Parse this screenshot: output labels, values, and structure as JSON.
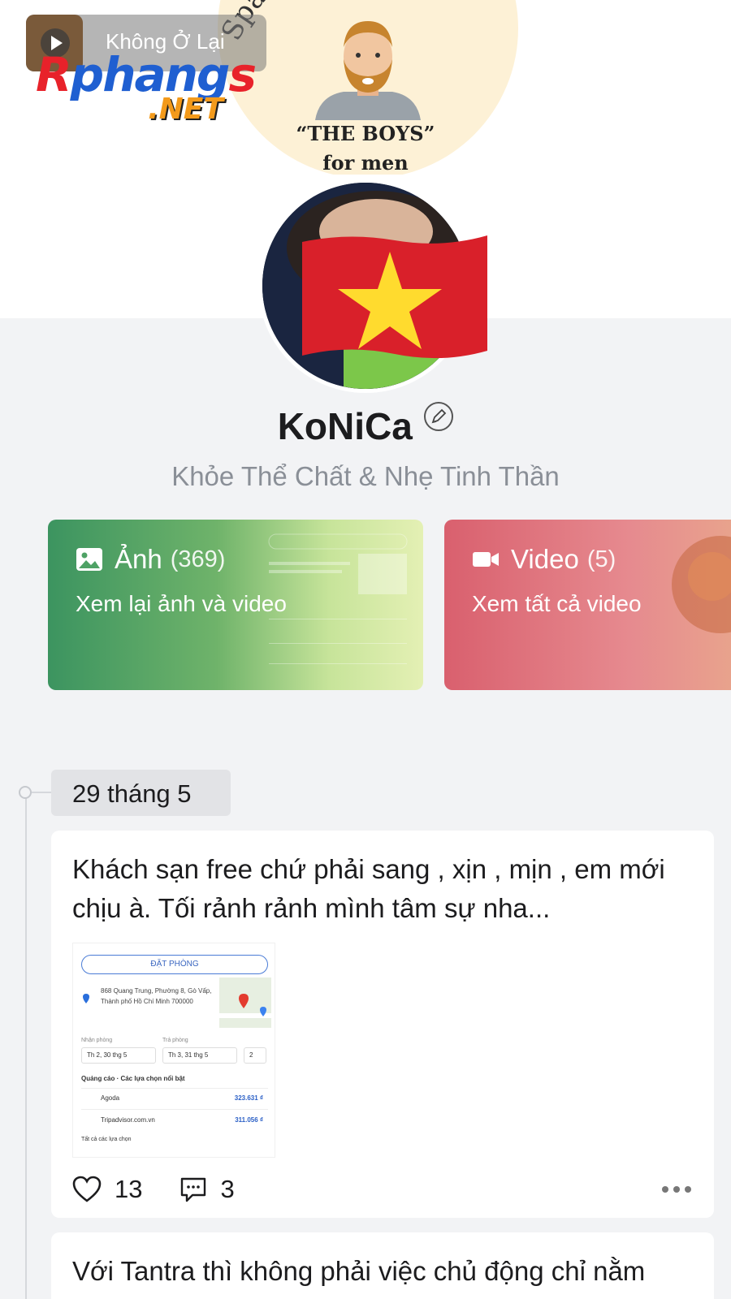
{
  "media": {
    "title": "Không Ở Lại"
  },
  "watermark": {
    "brand_r": "R",
    "brand_rest": "phang",
    "brand_s": "s",
    "domain": ".NET"
  },
  "cover": {
    "arc_text": "Spa & Massages",
    "title": "“THE BOYS”",
    "subtitle": "for men"
  },
  "profile": {
    "name": "KoNiCa",
    "bio": "Khỏe Thể Chất & Nhẹ Tinh Thần"
  },
  "cards": {
    "photo": {
      "label": "Ảnh",
      "count": "(369)",
      "sub": "Xem lại ảnh và video"
    },
    "video": {
      "label": "Video",
      "count": "(5)",
      "sub": "Xem tất cả video"
    }
  },
  "timeline": {
    "date": "29 tháng 5"
  },
  "posts": [
    {
      "text": "Khách sạn free chứ phải sang  , xịn , mịn , em mới chịu à. Tối rảnh rảnh mình tâm sự nha...",
      "likes": "13",
      "comments": "3",
      "image": {
        "button": "ĐẶT PHÒNG",
        "address": "868 Quang Trung, Phường 8, Gò Vấp, Thành phố Hồ Chí Minh 700000",
        "checkin_label": "Nhận phòng",
        "checkout_label": "Trả phòng",
        "checkin": "Th 2, 30 thg 5",
        "checkout": "Th 3, 31 thg 5",
        "guests": "2",
        "ads_label": "Quảng cáo · Các lựa chọn nổi bật",
        "offers": [
          {
            "name": "Agoda",
            "price": "323.631 ₫"
          },
          {
            "name": "Tripadvisor.com.vn",
            "price": "311.056 ₫"
          }
        ],
        "all_options": "Tất cả các lựa chọn"
      }
    },
    {
      "text": "Với Tantra thì không phải việc chủ động chỉ nằm"
    }
  ],
  "colors": {
    "photo_card": "#3c9460",
    "video_card": "#d9606e",
    "background": "#f2f3f5"
  },
  "icons": [
    "play-icon",
    "edit-icon",
    "image-icon",
    "video-camera-icon",
    "heart-icon",
    "comment-icon",
    "more-icon",
    "location-pin-icon"
  ]
}
